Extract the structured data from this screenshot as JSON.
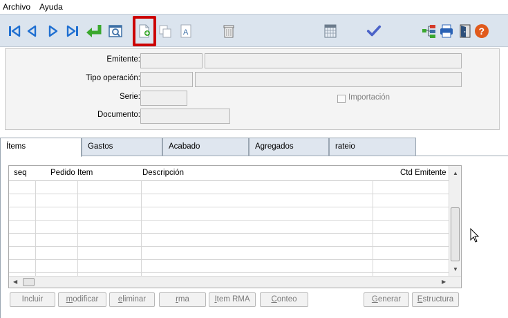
{
  "menu": {
    "archivo": "Archivo",
    "ayuda": "Ayuda"
  },
  "toolbar": {
    "buttons": [
      "first-record-icon",
      "prev-record-icon",
      "next-record-icon",
      "last-record-icon",
      "enter-icon",
      "preview-icon",
      "new-document-icon",
      "copy-icon",
      "font-icon",
      "trash-icon",
      "calendar-icon",
      "check-icon",
      "tree-icon",
      "print-icon",
      "exit-door-icon",
      "help-icon"
    ]
  },
  "header": {
    "emitente_label": "Emitente:",
    "tipo_operacion_label": "Tipo operación:",
    "serie_label": "Serie:",
    "documento_label": "Documento:",
    "importacion_label": "Importación"
  },
  "tabs": [
    "Ítems",
    "Gastos",
    "Acabado",
    "Agregados",
    "rateio"
  ],
  "grid": {
    "columns": [
      "seq",
      "Pedido Item",
      "Descripción",
      "Ctd Emitente"
    ],
    "rows": 7
  },
  "buttons": {
    "incluir": "Incluir",
    "modificar_key": "m",
    "modificar_rest": "odificar",
    "eliminar_key": "e",
    "eliminar_rest": "liminar",
    "rma_key": "r",
    "rma_rest": "ma",
    "item_rma_key": "I",
    "item_rma_rest": "tem RMA",
    "conteo_key": "C",
    "conteo_rest": "onteo",
    "generar_key": "G",
    "generar_rest": "enerar",
    "estructura_key": "E",
    "estructura_rest": "structura"
  },
  "colors": {
    "highlight": "#cc0000",
    "toolbar_bg": "#dbe4ee",
    "nav_blue": "#1f6fd1"
  }
}
